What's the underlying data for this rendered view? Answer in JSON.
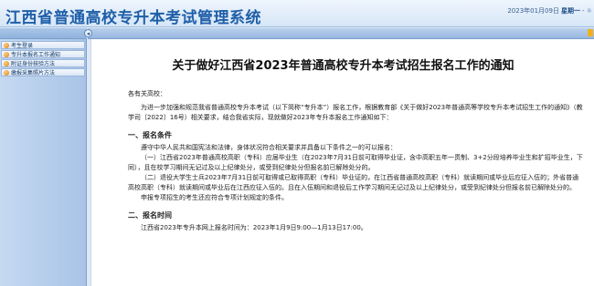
{
  "header": {
    "title": "江西省普通高校专升本考试管理系统",
    "date": "2023年01月09日",
    "weekday": "星期一",
    "trailing": "- ☼"
  },
  "sidebar": {
    "items": [
      {
        "label": "考生登录"
      },
      {
        "label": "专升本报名工作通知"
      },
      {
        "label": "附证身份核验方法"
      },
      {
        "label": "缴报采集照片方法"
      }
    ]
  },
  "toolbar": {
    "toggle_glyph": "◂"
  },
  "notice": {
    "title": "关于做好江西省2023年普通高校专升本考试招生报名工作的通知",
    "greeting": "各有关高校：",
    "intro": "为进一步加强和规范我省普通高校专升本考试（以下简称“专升本”）报名工作，根据教育部《关于做好2023年普通高等学校专升本考试招生工作的通知》（教学司〔2022〕16号）相关要求，结合我省实际，现就做好2023年专升本报名工作通知如下：",
    "section1_title": "一、报名条件",
    "s1_p1": "遵守中华人民共和国宪法和法律，身体状况符合相关要求并具备以下条件之一的可以报名：",
    "s1_p2": "（一）江西省2023年普通高校高职（专科）应届毕业生（在2023年7月31日前可取得毕业证，含中高职五年一贯制、3+2分段培养毕业生和扩招毕业生，下同），且在校学习期间无记过及以上纪律处分，或受到纪律处分但报名前已解除处分的。",
    "s1_p3": "（二）退役大学生士兵2023年7月31日前可取得或已取得高职（专科）毕业证的，在江西省普通高校高职（专科）就读期间或毕业后应征入伍的；外省普通高校高职（专科）就读期间或毕业后在江西应征入伍的。且在入伍期间和退役后工作学习期间无记过及以上纪律处分，或受到纪律处分但报名前已解除处分的。",
    "s1_p4": "申报专项招生的考生还应符合专项计划规定的条件。",
    "section2_title": "二、报名时间",
    "s2_p1": "江西省2023年专升本网上报名时间为：2023年1月9日9:00—1月13日17:00。"
  },
  "colors": {
    "title_blue": "#1f5fa8",
    "sidebar_blue": "#a8c4e7",
    "page_bg": "#dfe9f5",
    "accent_orange": "#e07b10"
  }
}
